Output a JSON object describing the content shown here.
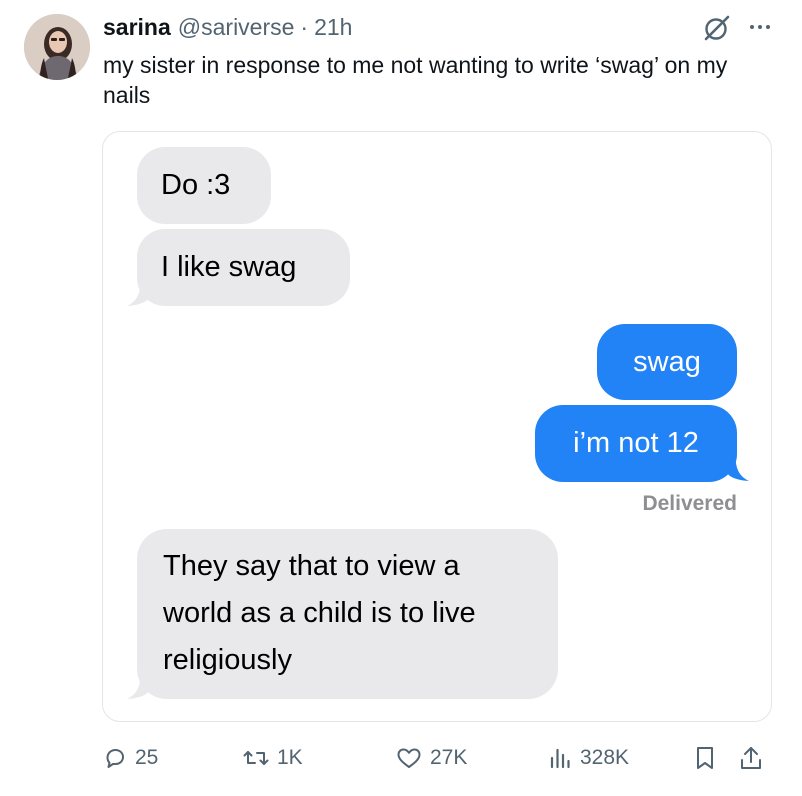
{
  "author": {
    "name": "sarina",
    "handle": "@sariverse",
    "separator": "·",
    "time": "21h"
  },
  "tweet": {
    "text": "my sister in response to me not wanting to write ‘swag’ on my nails"
  },
  "conversation": {
    "messages": [
      {
        "sender": "them",
        "text": "Do :3"
      },
      {
        "sender": "them",
        "text": "I like swag"
      },
      {
        "sender": "me",
        "text": "swag"
      },
      {
        "sender": "me",
        "text": "i’m not 12"
      },
      {
        "sender": "them",
        "text": "They say that to view a world as a child is to live religiously"
      }
    ],
    "status": "Delivered",
    "colors": {
      "incoming": "#e9e9eb",
      "outgoing": "#2283f6"
    }
  },
  "actions": {
    "replies": "25",
    "reposts": "1K",
    "likes": "27K",
    "views": "328K"
  },
  "icons": [
    "grok-icon",
    "more-icon",
    "reply-icon",
    "repost-icon",
    "like-icon",
    "views-icon",
    "bookmark-icon",
    "share-icon"
  ]
}
